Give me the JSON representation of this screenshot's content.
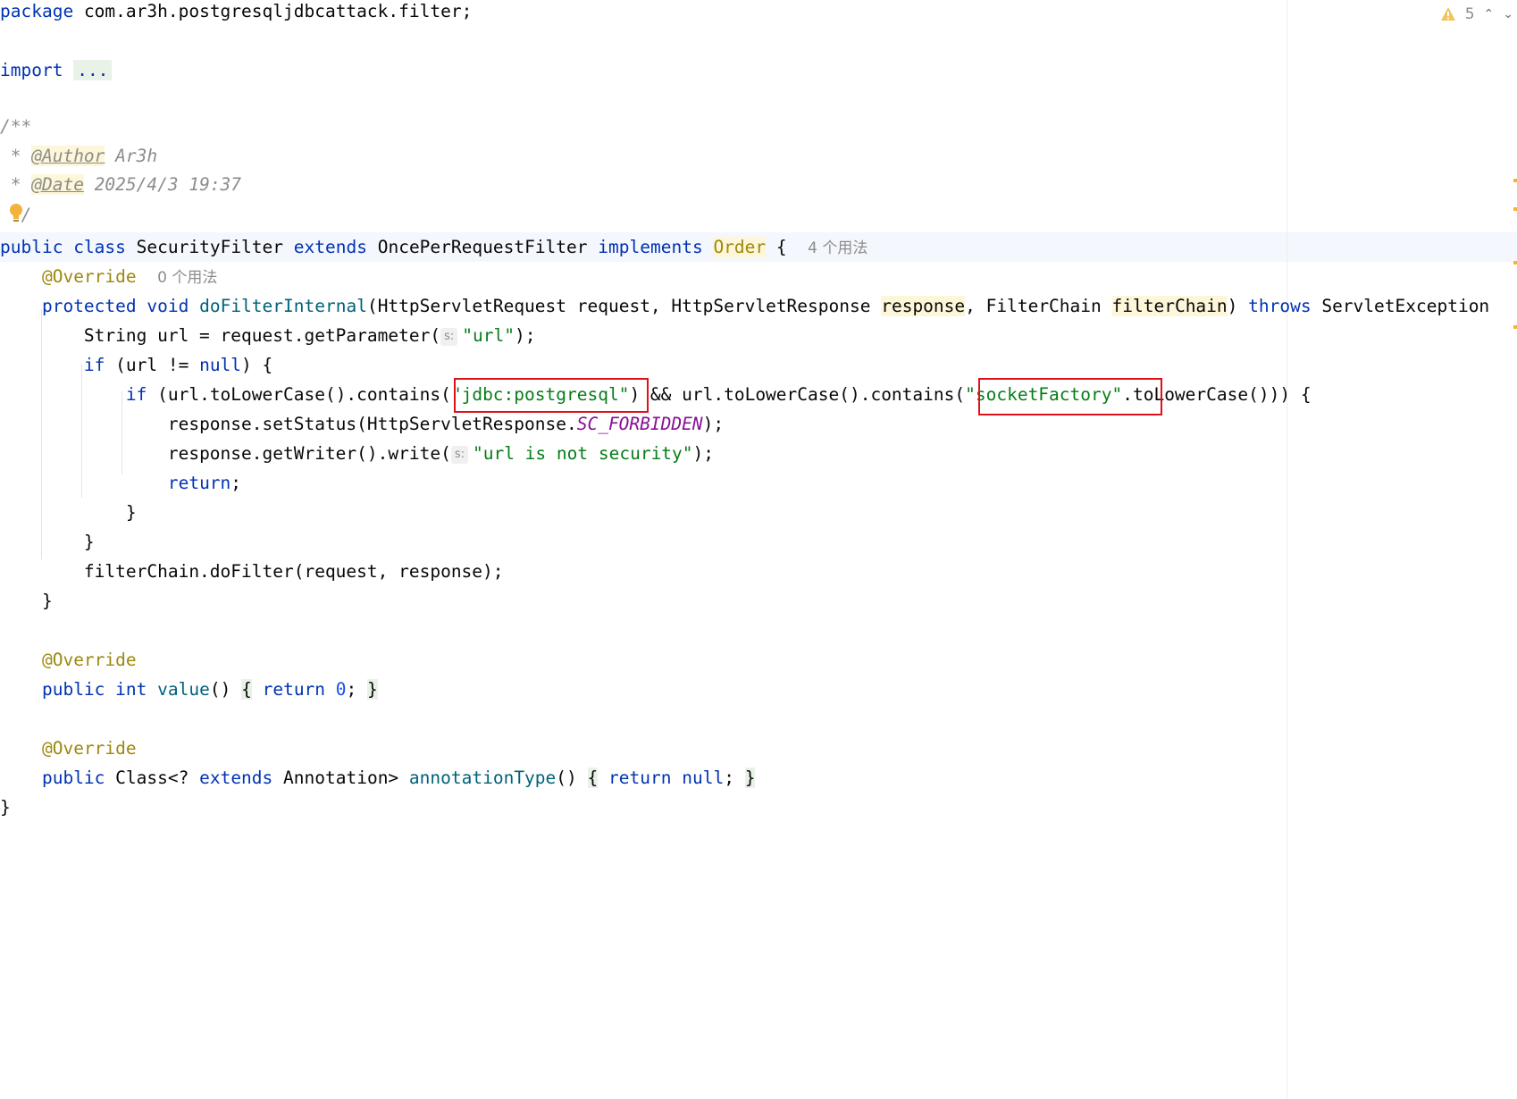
{
  "status": {
    "warning_count": "5"
  },
  "code": {
    "package_kw": "package",
    "package_name": "com.ar3h.postgresqljdbcattack.filter;",
    "import_kw": "import",
    "import_fold": "...",
    "doc_open": "/**",
    "doc_star": " * ",
    "author_tag": "@Author",
    "author_val": " Ar3h",
    "date_tag": "@Date",
    "date_val": " 2025/4/3 19:37",
    "doc_close": " */",
    "public": "public",
    "class": "class",
    "class_name": "SecurityFilter",
    "extends": "extends",
    "parent_name": "OncePerRequestFilter",
    "implements": "implements",
    "interface_name": "Order",
    "open_brace": "{",
    "class_usages": "4 个用法",
    "override": "@Override",
    "method_usages": "0 个用法",
    "protected": "protected",
    "void": "void",
    "method_name": "doFilterInternal",
    "sig_part1": "(HttpServletRequest request, HttpServletResponse ",
    "param_response": "response",
    "sig_part2": ", FilterChain ",
    "param_filterchain": "filterChain",
    "sig_part3": ") ",
    "throws": "throws",
    "throws_type": " ServletException",
    "l1_pre": "String url = request.getParameter(",
    "inlay_s": "s:",
    "str_url": "\"url\"",
    "l1_post": ");",
    "if": "if",
    "l2_pre": " (url != ",
    "null": "null",
    "l2_post": ") {",
    "l3_pre": " (url.toLowerCase().contains(",
    "str_jdbc": "\"jdbc:postgresql\"",
    "l3_mid": ") && url.toLowerCase().contains(",
    "str_socket": "\"socketFactory\"",
    "l3_post": ".toLowerCase())) {",
    "l4_pre": "response.setStatus(HttpServletResponse.",
    "sc_forbidden": "SC_FORBIDDEN",
    "l4_post": ");",
    "l5_pre": "response.getWriter().write(",
    "str_msg": "\"url is not security\"",
    "l5_post": ");",
    "return": "return",
    "semi": ";",
    "close_brace": "}",
    "l6": "filterChain.doFilter(request, response);",
    "int": "int",
    "value_fn": "value",
    "parens": "()",
    "zero": "0",
    "class_type": "Class<? ",
    "annotation_type": "Annotation> ",
    "annotationType_fn": "annotationType"
  }
}
